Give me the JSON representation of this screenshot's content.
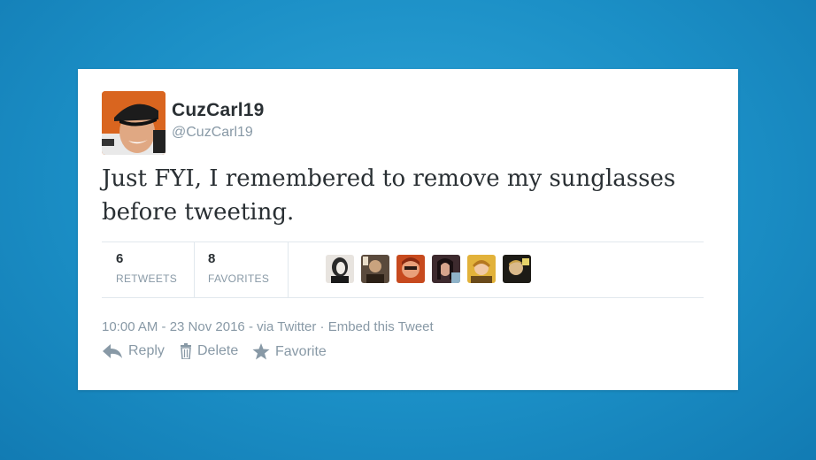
{
  "tweet": {
    "display_name": "CuzCarl19",
    "handle": "@CuzCarl19",
    "text": "Just FYI, I remembered to remove my sunglasses before tweeting.",
    "retweets_count": "6",
    "retweets_label": "RETWEETS",
    "favorites_count": "8",
    "favorites_label": "FAVORITES",
    "timestamp": "10:00 AM - 23 Nov 2016",
    "via": "via Twitter",
    "embed_label": "Embed this Tweet"
  },
  "actions": {
    "reply_label": "Reply",
    "delete_label": "Delete",
    "favorite_label": "Favorite"
  },
  "favoriter_avatars": [
    "user-avatar",
    "user-avatar",
    "user-avatar",
    "user-avatar",
    "user-avatar",
    "user-avatar"
  ],
  "icons": {
    "reply": "reply-icon",
    "delete": "trash-icon",
    "favorite": "star-icon"
  },
  "colors": {
    "background": "#1b8fc6",
    "card": "#ffffff",
    "text": "#292f33",
    "muted": "#8899a6",
    "divider": "#e1e8ed"
  }
}
